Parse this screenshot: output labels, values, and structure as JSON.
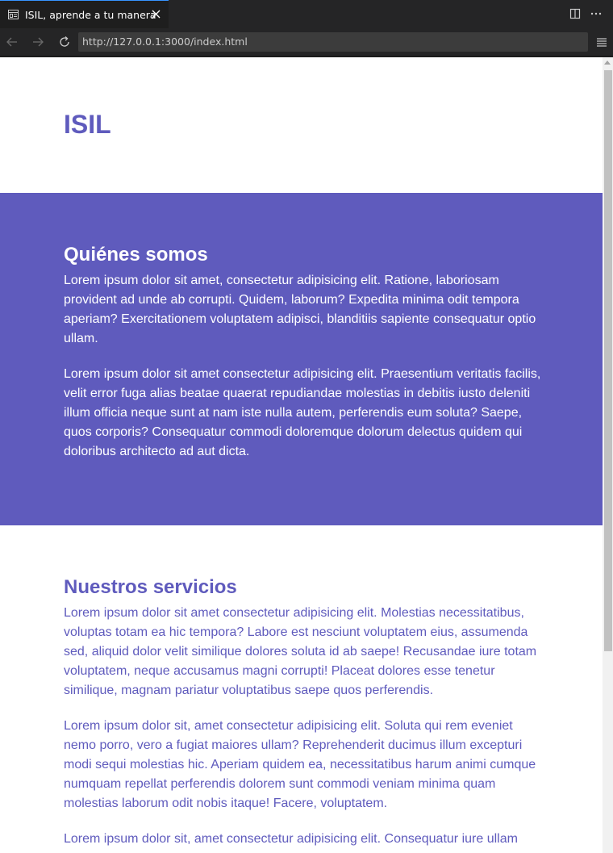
{
  "browser": {
    "tab_title": "ISIL, aprende a tu manera",
    "url": "http://127.0.0.1:3000/index.html"
  },
  "page": {
    "brand": "ISIL",
    "about": {
      "heading": "Quiénes somos",
      "paragraphs": [
        "Lorem ipsum dolor sit amet, consectetur adipisicing elit. Ratione, laboriosam provident ad unde ab corrupti. Quidem, laborum? Expedita minima odit tempora aperiam? Exercitationem voluptatem adipisci, blanditiis sapiente consequatur optio ullam.",
        "Lorem ipsum dolor sit amet consectetur adipisicing elit. Praesentium veritatis facilis, velit error fuga alias beatae quaerat repudiandae molestias in debitis iusto deleniti illum officia neque sunt at nam iste nulla autem, perferendis eum soluta? Saepe, quos corporis? Consequatur commodi doloremque dolorum delectus quidem qui doloribus architecto ad aut dicta."
      ]
    },
    "services": {
      "heading": "Nuestros servicios",
      "paragraphs": [
        "Lorem ipsum dolor sit amet consectetur adipisicing elit. Molestias necessitatibus, voluptas totam ea hic tempora? Labore est nesciunt voluptatem eius, assumenda sed, aliquid dolor velit similique dolores soluta id ab saepe! Recusandae iure totam voluptatem, neque accusamus magni corrupti! Placeat dolores esse tenetur similique, magnam pariatur voluptatibus saepe quos perferendis.",
        "Lorem ipsum dolor sit, amet consectetur adipisicing elit. Soluta qui rem eveniet nemo porro, vero a fugiat maiores ullam? Reprehenderit ducimus illum excepturi modi sequi molestias hic. Aperiam quidem ea, necessitatibus harum animi cumque numquam repellat perferendis dolorem sunt commodi veniam minima quam molestias laborum odit nobis itaque! Facere, voluptatem.",
        "Lorem ipsum dolor sit, amet consectetur adipisicing elit. Consequatur iure ullam"
      ]
    }
  },
  "colors": {
    "accent": "#5f5bbd",
    "chrome_bg": "#252526",
    "active_tab_border": "#3794ff"
  }
}
